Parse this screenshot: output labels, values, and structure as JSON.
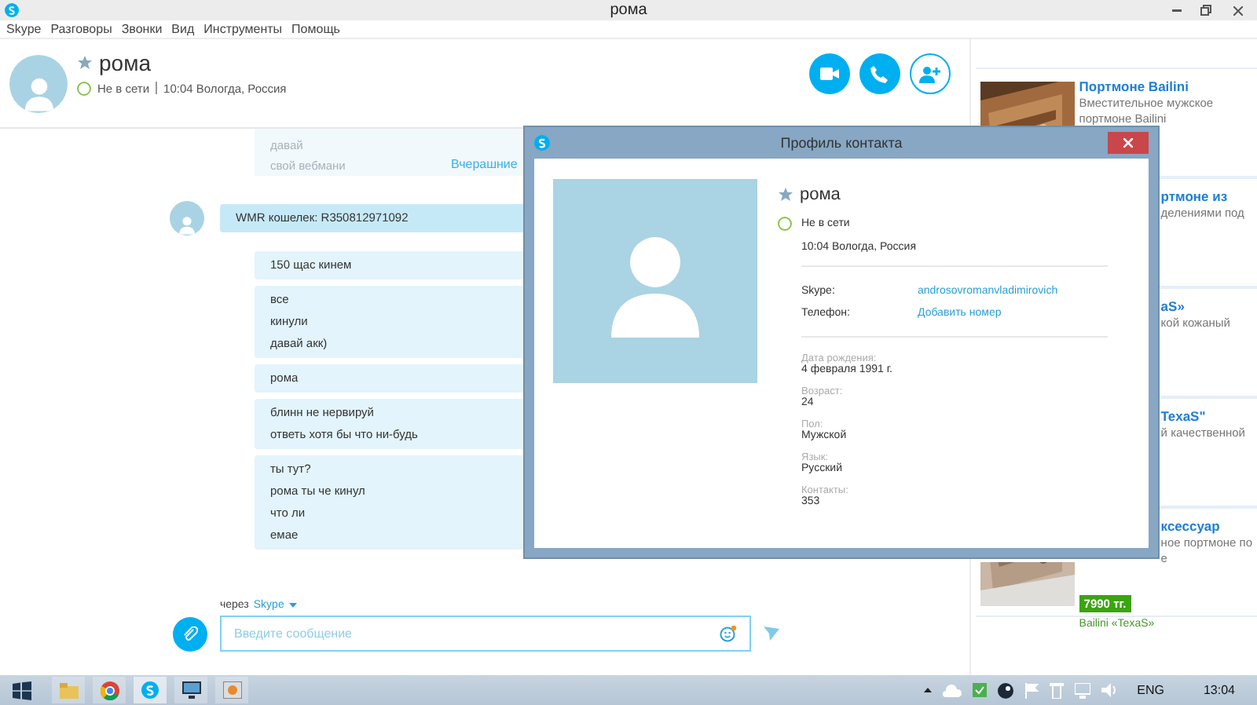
{
  "window": {
    "title": "рома"
  },
  "menu": [
    "Skype",
    "Разговоры",
    "Звонки",
    "Вид",
    "Инструменты",
    "Помощь"
  ],
  "contact": {
    "name": "рома",
    "status": "Не в сети",
    "local_info": "10:04 Вологда, Россия"
  },
  "chat": {
    "faded_lines": [
      "давай",
      "свой вебмани"
    ],
    "history_link": "Вчерашние",
    "messages": [
      {
        "kind": "incoming",
        "lines": [
          "WMR кошелек: R350812971092"
        ]
      },
      {
        "kind": "outgoing",
        "lines": [
          "150 щас кинем"
        ]
      },
      {
        "kind": "outgoing",
        "lines": [
          "все",
          "кинули",
          "давай акк)"
        ]
      },
      {
        "kind": "outgoing",
        "lines": [
          "рома"
        ]
      },
      {
        "kind": "outgoing",
        "lines": [
          "блинн не нервируй",
          "ответь хотя бы что ни-будь"
        ]
      },
      {
        "kind": "outgoing",
        "lines": [
          "ты тут?",
          "рома ты че кинул",
          "что ли",
          "емае"
        ]
      }
    ]
  },
  "compose": {
    "via_label": "через",
    "via_service": "Skype",
    "placeholder": "Введите сообщение"
  },
  "ads": [
    {
      "kind": "full",
      "title": "Портмоне Bailini",
      "lines": [
        "Вместительное мужское",
        "портмоне Bailini"
      ]
    },
    {
      "kind": "covered",
      "title": "ртмоне из",
      "lines": [
        "делениями под"
      ]
    },
    {
      "kind": "covered",
      "title": "aS»",
      "lines": [
        "кой кожаный"
      ]
    },
    {
      "kind": "covered",
      "title": "TexaS\"",
      "lines": [
        "й качественной"
      ]
    },
    {
      "kind": "bottom",
      "title": "ксессуар",
      "lines": [
        "ное портмоне по",
        "е"
      ],
      "price": "7990 тг.",
      "brand": "Bailini «TexaS»"
    }
  ],
  "dialog": {
    "title": "Профиль контакта",
    "name": "рома",
    "status": "Не в сети",
    "local_info": "10:04 Вологда, Россия",
    "fields": [
      {
        "kind": "link",
        "label": "Skype:",
        "value": "androsovromanvladimirovich"
      },
      {
        "kind": "link",
        "label": "Телефон:",
        "value": "Добавить номер"
      }
    ],
    "details": [
      {
        "label": "Дата рождения:",
        "value": "4 февраля 1991 г."
      },
      {
        "label": "Возраст:",
        "value": "24"
      },
      {
        "label": "Пол:",
        "value": "Мужской"
      },
      {
        "label": "Язык:",
        "value": "Русский"
      },
      {
        "label": "Контакты:",
        "value": "353"
      }
    ]
  },
  "taskbar": {
    "language": "ENG",
    "time": "13:04"
  }
}
